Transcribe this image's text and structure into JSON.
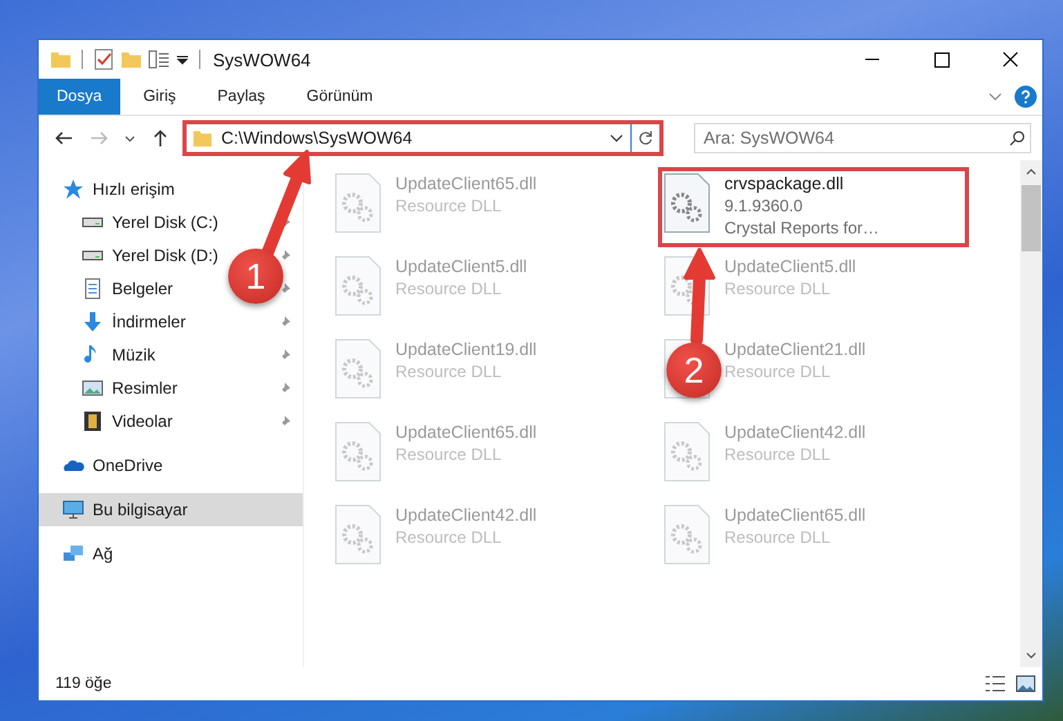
{
  "window": {
    "title": "SysWOW64"
  },
  "ribbon_tabs": [
    {
      "label": "Dosya",
      "selected": true
    },
    {
      "label": "Giriş",
      "selected": false
    },
    {
      "label": "Paylaş",
      "selected": false
    },
    {
      "label": "Görünüm",
      "selected": false
    }
  ],
  "address": {
    "path": "C:\\Windows\\SysWOW64",
    "highlighted": true
  },
  "search": {
    "placeholder": "Ara: SysWOW64"
  },
  "sidebar": {
    "items": [
      {
        "label": "Hızlı erişim",
        "selected": false,
        "children": [
          {
            "label": "Yerel Disk (C:)",
            "pinned": true,
            "selected": false
          },
          {
            "label": "Yerel Disk (D:)",
            "pinned": true,
            "selected": false
          },
          {
            "label": "Belgeler",
            "pinned": true,
            "selected": false
          },
          {
            "label": "İndirmeler",
            "pinned": true,
            "selected": false
          },
          {
            "label": "Müzik",
            "pinned": true,
            "selected": false
          },
          {
            "label": "Resimler",
            "pinned": true,
            "selected": false
          },
          {
            "label": "Videolar",
            "pinned": true,
            "selected": false
          }
        ]
      },
      {
        "label": "OneDrive",
        "selected": false
      },
      {
        "label": "Bu bilgisayar",
        "selected": true
      },
      {
        "label": "Ağ",
        "selected": false
      }
    ]
  },
  "files": [
    {
      "name": "UpdateClient65.dll",
      "lines": [
        "Resource DLL"
      ],
      "blurred": true,
      "highlighted": false
    },
    {
      "name": "crvspackage.dll",
      "lines": [
        "9.1.9360.0",
        "Crystal Reports for…"
      ],
      "blurred": false,
      "highlighted": true
    },
    {
      "name": "UpdateClient5.dll",
      "lines": [
        "Resource DLL"
      ],
      "blurred": true,
      "highlighted": false
    },
    {
      "name": "UpdateClient5.dll",
      "lines": [
        "Resource DLL"
      ],
      "blurred": true,
      "highlighted": false
    },
    {
      "name": "UpdateClient19.dll",
      "lines": [
        "Resource DLL"
      ],
      "blurred": true,
      "highlighted": false
    },
    {
      "name": "UpdateClient21.dll",
      "lines": [
        "Resource DLL"
      ],
      "blurred": true,
      "highlighted": false
    },
    {
      "name": "UpdateClient65.dll",
      "lines": [
        "Resource DLL"
      ],
      "blurred": true,
      "highlighted": false
    },
    {
      "name": "UpdateClient42.dll",
      "lines": [
        "Resource DLL"
      ],
      "blurred": true,
      "highlighted": false
    },
    {
      "name": "UpdateClient42.dll",
      "lines": [
        "Resource DLL"
      ],
      "blurred": true,
      "highlighted": false
    },
    {
      "name": "UpdateClient65.dll",
      "lines": [
        "Resource DLL"
      ],
      "blurred": true,
      "highlighted": false
    }
  ],
  "callouts": [
    {
      "number": "1"
    },
    {
      "number": "2"
    }
  ],
  "status_bar": {
    "count": "119 öğe"
  }
}
